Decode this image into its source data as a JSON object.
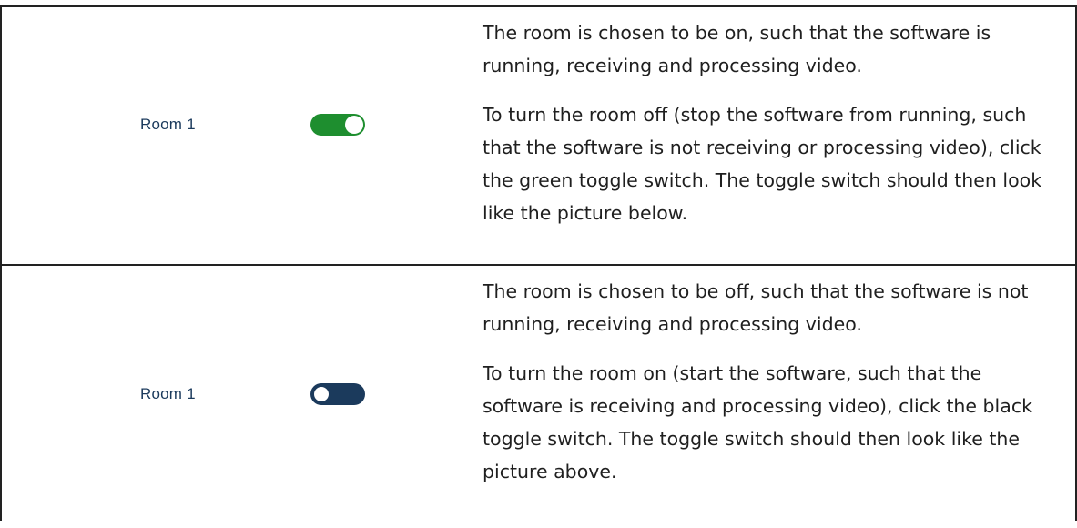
{
  "rows": [
    {
      "room_label": "Room 1",
      "toggle_state": "on",
      "toggle_color": "#1e8e2f",
      "paragraph_1": "The room is chosen to be on, such that the software is running, receiving and processing video.",
      "paragraph_2": "To turn the room off (stop the software from running, such that the software is not receiving or processing video), click the green toggle switch. The toggle switch should then look like the picture below."
    },
    {
      "room_label": "Room 1",
      "toggle_state": "off",
      "toggle_color": "#1b3a5c",
      "paragraph_1": "The room is chosen to be off, such that the software is not running, receiving and processing video.",
      "paragraph_2": "To turn the room on (start the software, such that the software is receiving and processing video), click the black toggle switch. The toggle switch should then look like the picture above."
    }
  ]
}
